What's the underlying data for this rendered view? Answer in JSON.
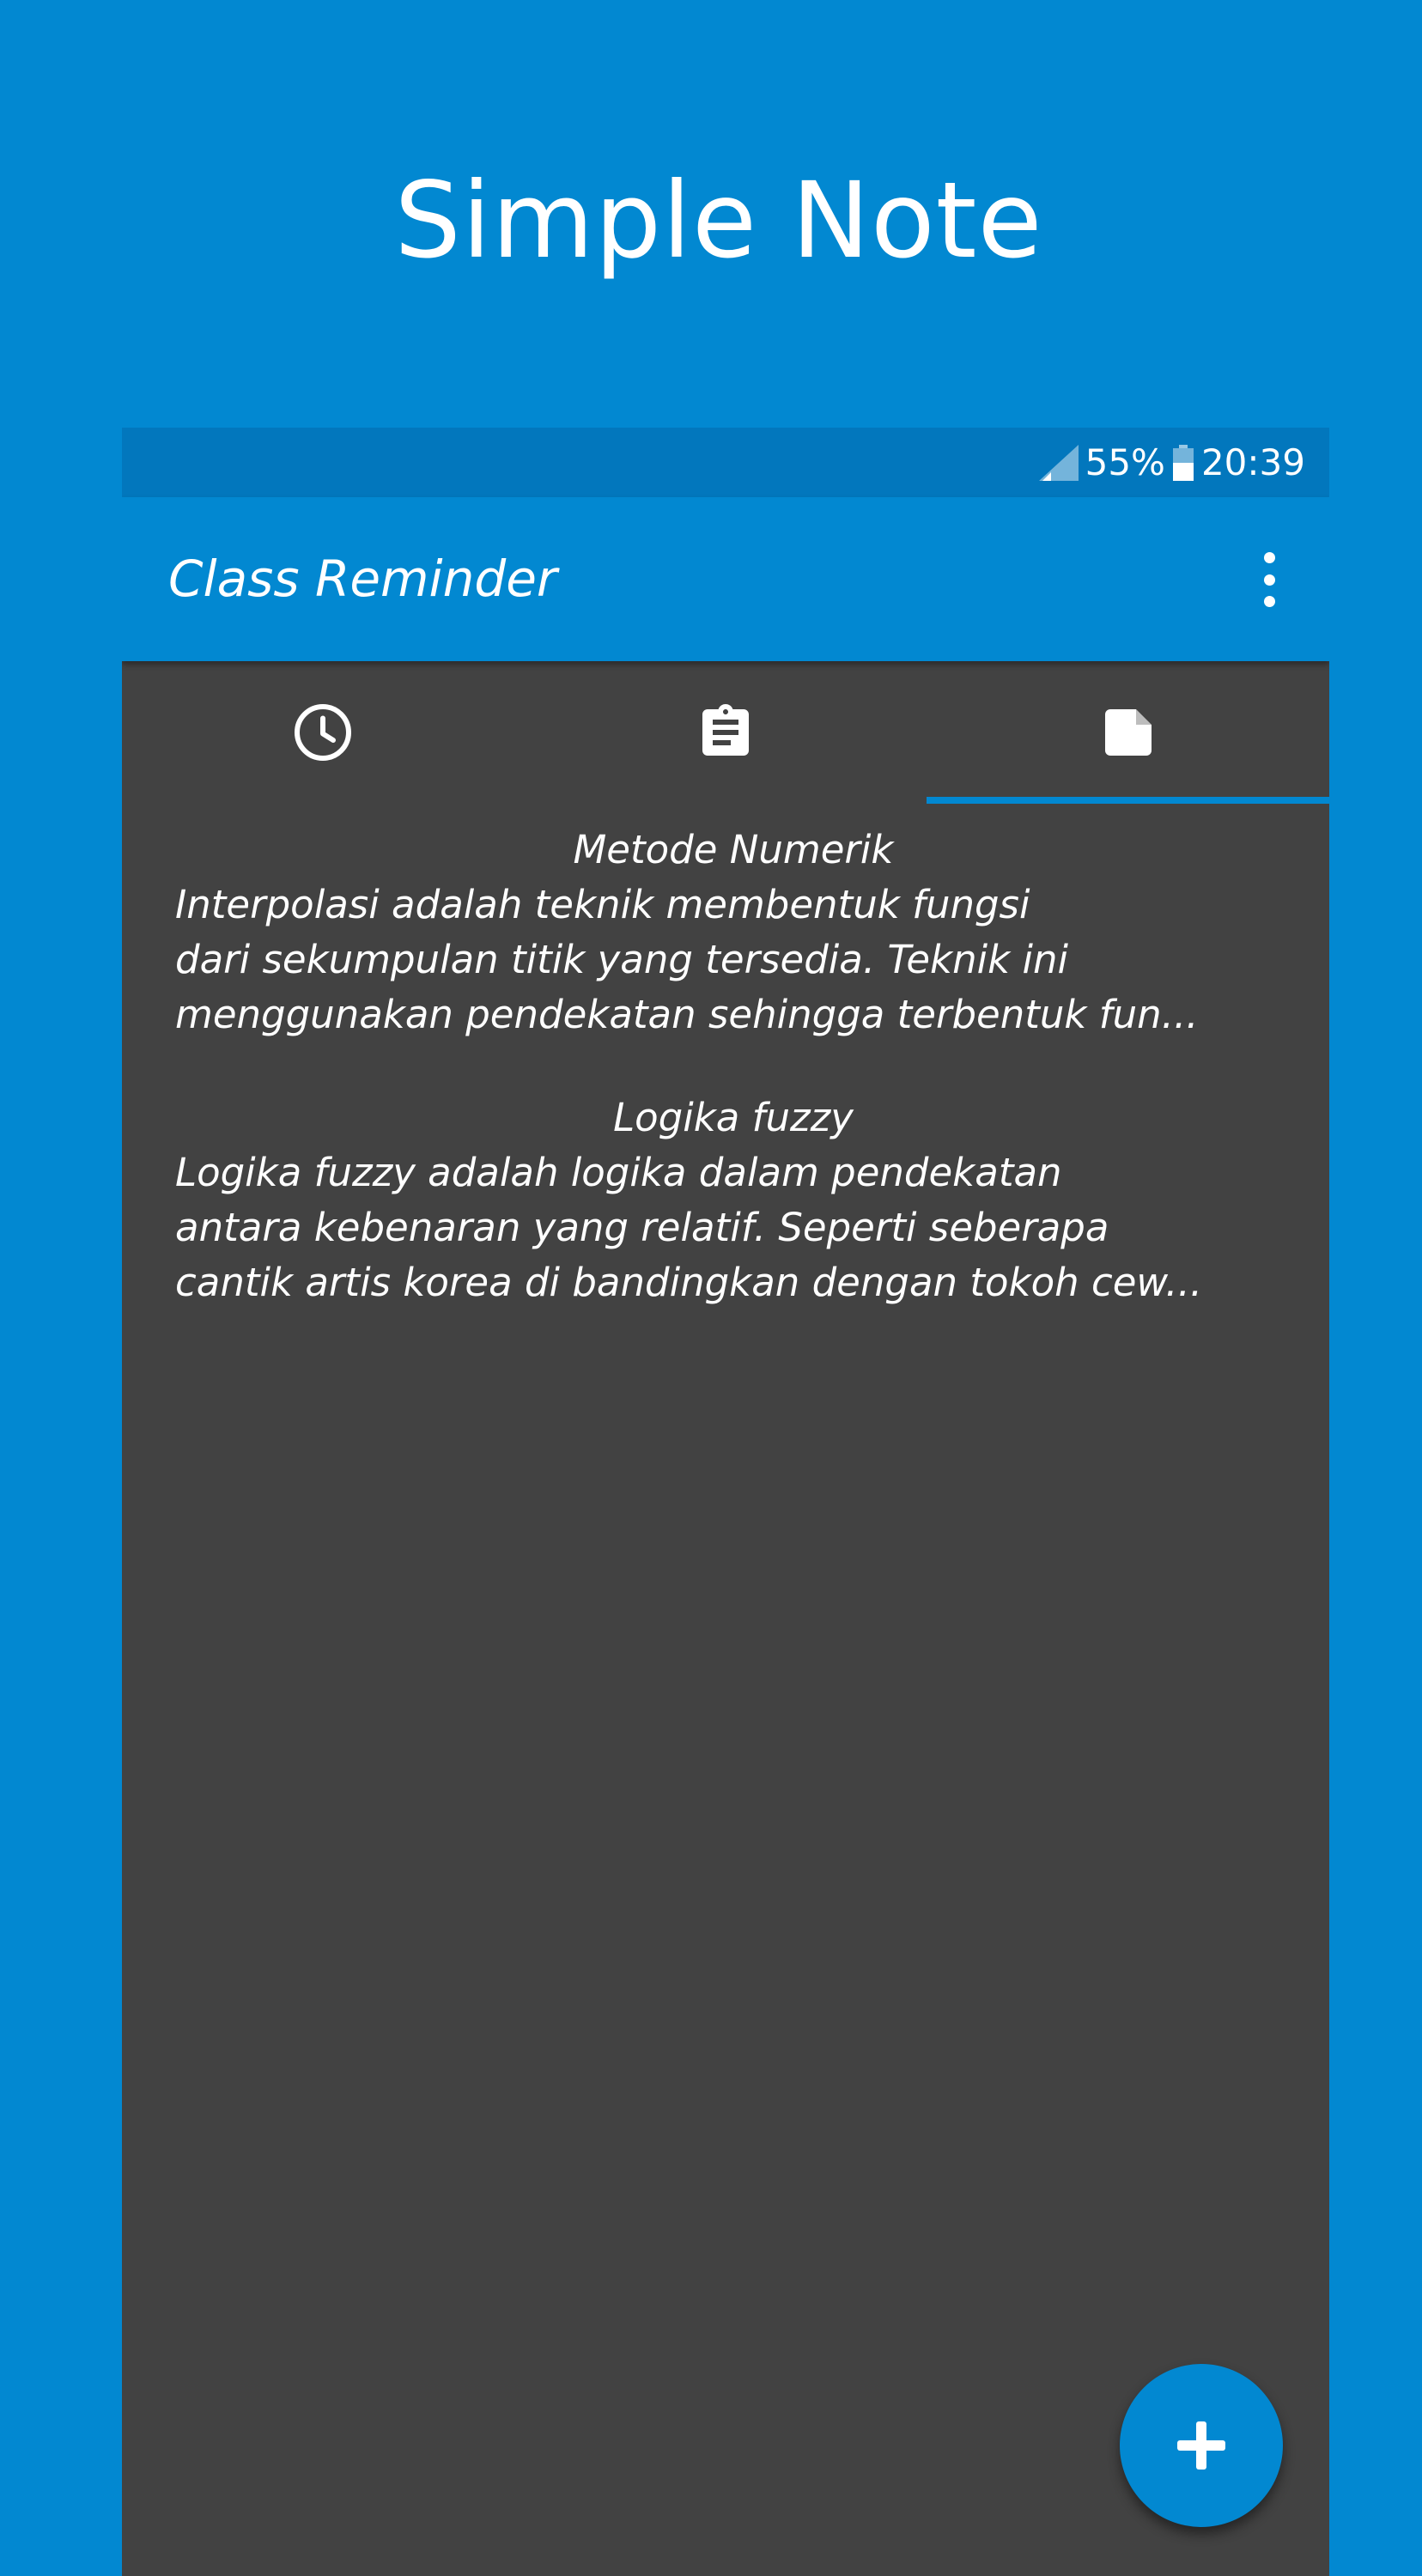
{
  "promo": {
    "title": "Simple Note"
  },
  "status_bar": {
    "battery": "55%",
    "time": "20:39",
    "icons": [
      "signal-icon",
      "battery-icon"
    ]
  },
  "app_bar": {
    "title": "Class Reminder",
    "overflow_icon": "more-vertical-icon"
  },
  "tabs": [
    {
      "icon": "clock-icon",
      "selected": false
    },
    {
      "icon": "clipboard-icon",
      "selected": false
    },
    {
      "icon": "note-icon",
      "selected": true
    }
  ],
  "notes": [
    {
      "title": "Metode Numerik",
      "lines": [
        "Interpolasi adalah teknik membentuk fungsi",
        "dari sekumpulan titik yang tersedia. Teknik ini",
        "menggunakan pendekatan sehingga terbentuk fun..."
      ]
    },
    {
      "title": "Logika fuzzy",
      "lines": [
        "Logika fuzzy adalah logika dalam pendekatan",
        "antara kebenaran yang relatif. Seperti seberapa",
        "cantik artis korea di bandingkan dengan tokoh cew..."
      ]
    }
  ],
  "fab": {
    "icon": "add-icon"
  },
  "colors": {
    "primary": "#0288d1",
    "primary_dark": "#0277bd",
    "background": "#424242",
    "text": "#ffffff"
  }
}
